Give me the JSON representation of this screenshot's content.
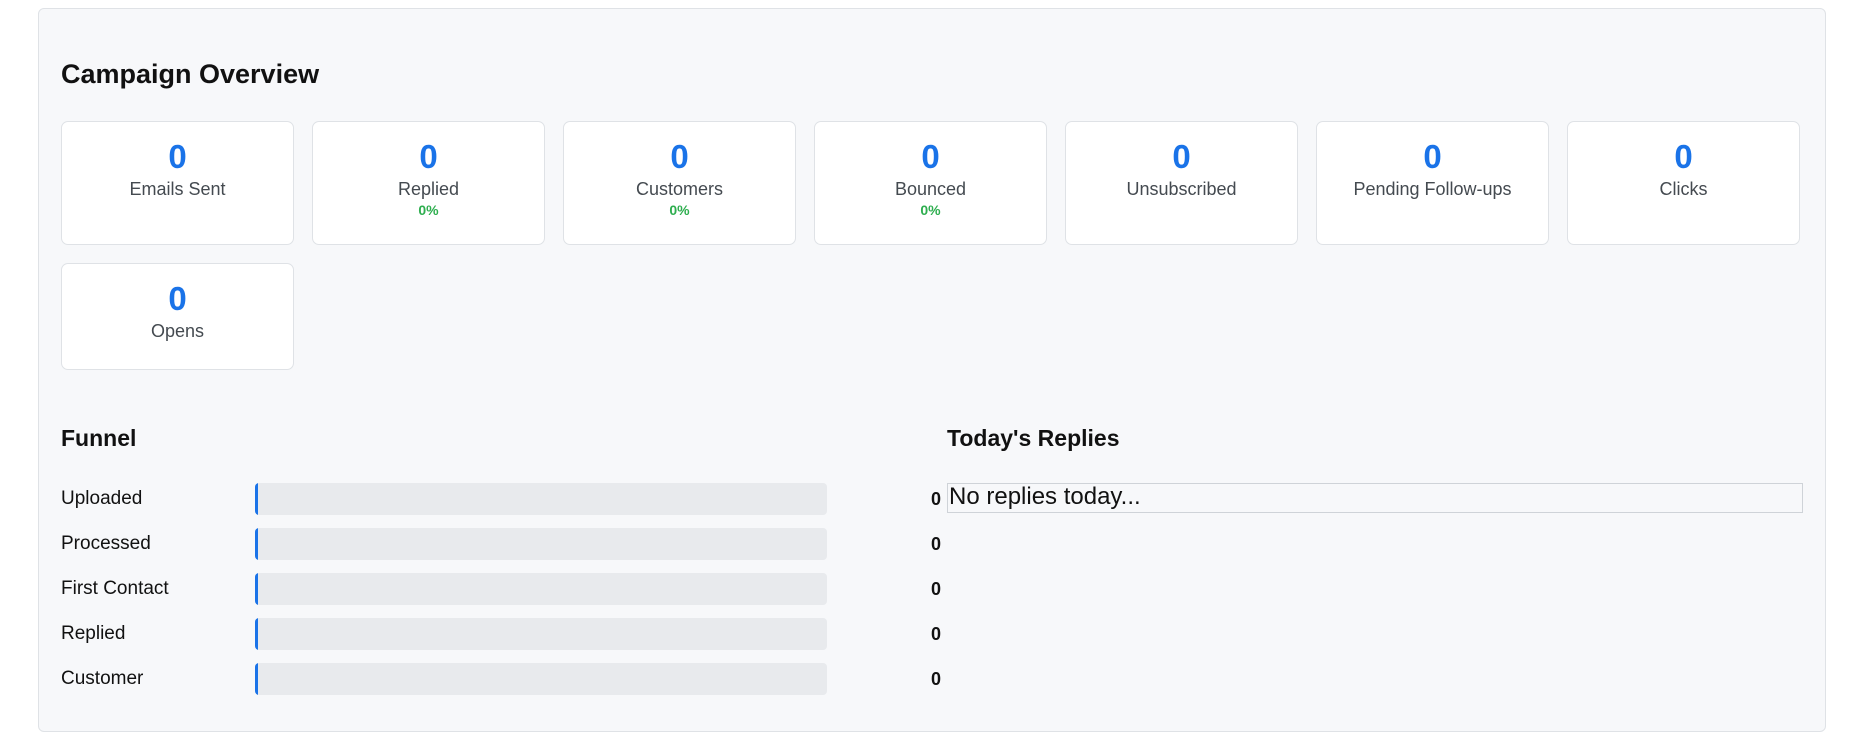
{
  "overview": {
    "title": "Campaign Overview",
    "stats": [
      {
        "value": "0",
        "label": "Emails Sent",
        "pct": ""
      },
      {
        "value": "0",
        "label": "Replied",
        "pct": "0%"
      },
      {
        "value": "0",
        "label": "Customers",
        "pct": "0%"
      },
      {
        "value": "0",
        "label": "Bounced",
        "pct": "0%"
      },
      {
        "value": "0",
        "label": "Unsubscribed",
        "pct": ""
      },
      {
        "value": "0",
        "label": "Pending Follow-ups",
        "pct": ""
      },
      {
        "value": "0",
        "label": "Clicks",
        "pct": ""
      },
      {
        "value": "0",
        "label": "Opens",
        "pct": ""
      }
    ]
  },
  "funnel": {
    "title": "Funnel",
    "stages": [
      {
        "label": "Uploaded",
        "count": "0",
        "fill_fraction": 0
      },
      {
        "label": "Processed",
        "count": "0",
        "fill_fraction": 0
      },
      {
        "label": "First Contact",
        "count": "0",
        "fill_fraction": 0
      },
      {
        "label": "Replied",
        "count": "0",
        "fill_fraction": 0
      },
      {
        "label": "Customer",
        "count": "0",
        "fill_fraction": 0
      }
    ]
  },
  "replies": {
    "title": "Today's Replies",
    "empty_text": "No replies today..."
  },
  "colors": {
    "accent": "#1a73e8",
    "positive": "#2eae4f"
  }
}
